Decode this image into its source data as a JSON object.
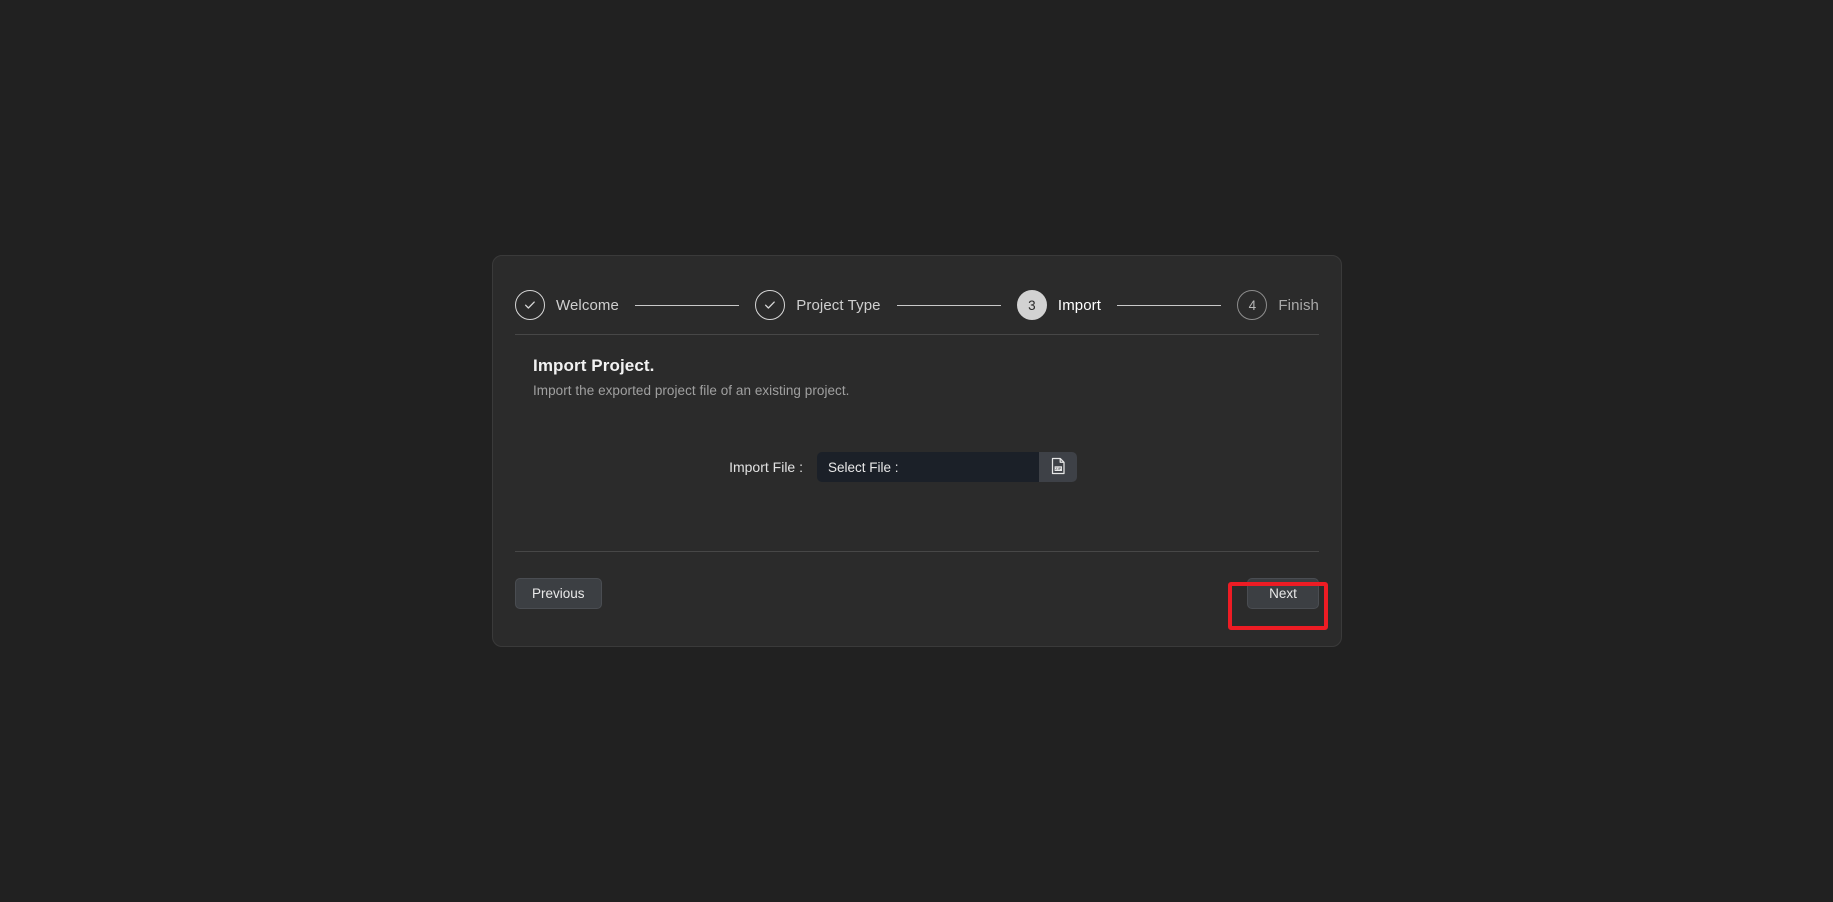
{
  "wizard": {
    "steps": [
      {
        "id": "welcome",
        "label": "Welcome",
        "marker": "check",
        "state": "done"
      },
      {
        "id": "project-type",
        "label": "Project Type",
        "marker": "check",
        "state": "done"
      },
      {
        "id": "import",
        "label": "Import",
        "marker": "3",
        "state": "active"
      },
      {
        "id": "finish",
        "label": "Finish",
        "marker": "4",
        "state": "pending"
      }
    ],
    "content": {
      "title": "Import Project.",
      "subtitle": "Import the exported project file of an existing project."
    },
    "form": {
      "import_file_label": "Import File :",
      "import_file_value": "",
      "import_file_placeholder": "Select File :",
      "browse_icon": "zip-file-icon"
    },
    "footer": {
      "previous_label": "Previous",
      "next_label": "Next"
    }
  },
  "annotation": {
    "target": "next-button",
    "color": "#ed1c24"
  },
  "theme": {
    "page_background": "#212121",
    "card_background": "#2b2b2b",
    "input_background": "#1b2028",
    "button_background": "#3c3f43",
    "active_marker": "#d2d2d2",
    "connector": "#c9c9c9"
  }
}
